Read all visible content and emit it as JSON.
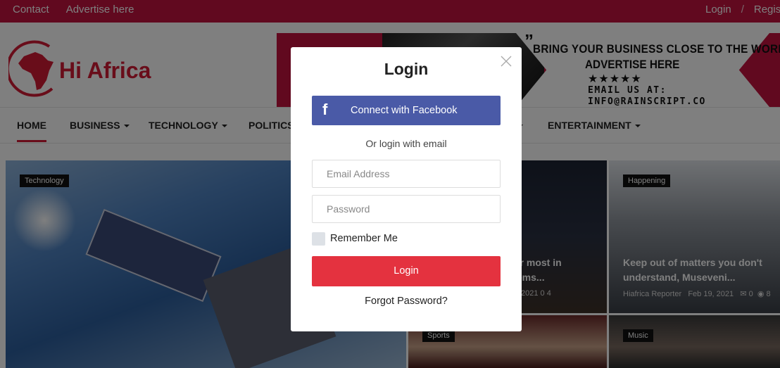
{
  "topbar": {
    "contact": "Contact",
    "advertise": "Advertise here",
    "login": "Login",
    "separator": "/",
    "register": "Register"
  },
  "logo": {
    "text": "Hi Africa"
  },
  "banner": {
    "line1": "BRING YOUR BUSINESS CLOSE TO THE WORLD",
    "line2": "ADVERTISE HERE",
    "stars": "★★★★★",
    "line3": "EMAIL US AT:",
    "line4": "INFO@RAINSCRIPT.CO",
    "quote": "”"
  },
  "nav": {
    "home": "HOME",
    "business": "BUSINESS",
    "technology": "TECHNOLOGY",
    "politics": "POLITICS",
    "entertainment": "ENTERTAINMENT"
  },
  "tiles": {
    "main": {
      "tag": "Technology"
    },
    "mid": {
      "title_l1": "or most in",
      "title_l2": "lems...",
      "meta": "2021   0   4"
    },
    "right": {
      "tag": "Happening",
      "title": "Keep out of matters you don't understand, Museveni...",
      "author": "Hiafrica Reporter",
      "date": "Feb 19, 2021",
      "comments": "0",
      "views": "8"
    },
    "bottom_mid": {
      "tag": "Sports"
    },
    "bottom_right": {
      "tag": "Music"
    }
  },
  "modal": {
    "title": "Login",
    "facebook_label": "Connect with Facebook",
    "facebook_icon": "f",
    "or_text": "Or login with email",
    "email_placeholder": "Email Address",
    "password_placeholder": "Password",
    "remember_label": "Remember Me",
    "login_button": "Login",
    "forgot": "Forgot Password?"
  },
  "colors": {
    "brand": "#c2123f",
    "facebook": "#4a5aa7",
    "login_button": "#e4323f"
  }
}
